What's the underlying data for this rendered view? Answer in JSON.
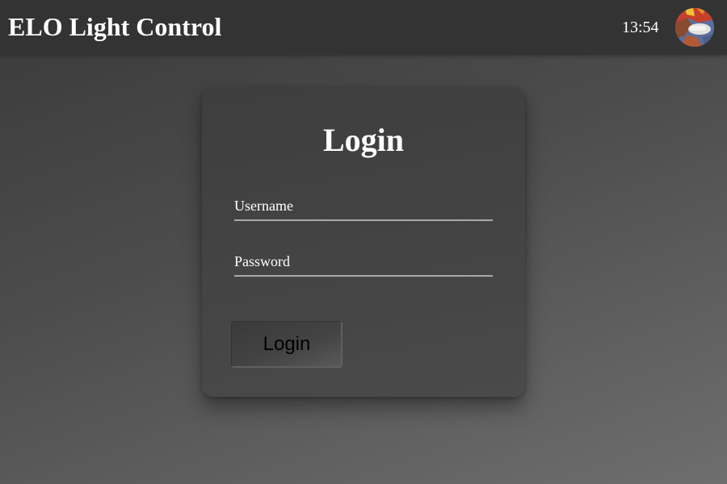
{
  "header": {
    "title": "ELO Light Control",
    "clock": "13:54",
    "avatar_icon": "user-avatar-icon"
  },
  "login_form": {
    "title": "Login",
    "username_label": "Username",
    "username_value": "",
    "password_label": "Password",
    "password_value": "",
    "submit_label": "Login"
  },
  "colors": {
    "topbar": "#333333",
    "card": "#444444",
    "accent_underline": "#a9a9a9",
    "text": "#ffffff"
  }
}
